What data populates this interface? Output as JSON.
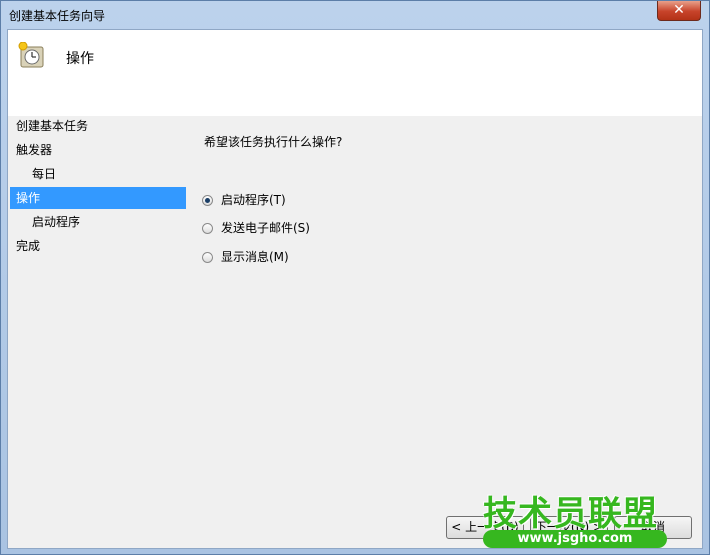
{
  "window": {
    "title": "创建基本任务向导",
    "close_label": "✕"
  },
  "header": {
    "title": "操作",
    "icon": "task-scheduler-clock-icon"
  },
  "nav": {
    "items": [
      {
        "label": "创建基本任务",
        "level": 0,
        "selected": false
      },
      {
        "label": "触发器",
        "level": 0,
        "selected": false
      },
      {
        "label": "每日",
        "level": 1,
        "selected": false
      },
      {
        "label": "操作",
        "level": 0,
        "selected": true
      },
      {
        "label": "启动程序",
        "level": 1,
        "selected": false
      },
      {
        "label": "完成",
        "level": 0,
        "selected": false
      }
    ]
  },
  "main": {
    "question": "希望该任务执行什么操作?",
    "options": [
      {
        "label": "启动程序(T)",
        "checked": true
      },
      {
        "label": "发送电子邮件(S)",
        "checked": false
      },
      {
        "label": "显示消息(M)",
        "checked": false
      }
    ]
  },
  "buttons": {
    "back": "< 上一步(B)",
    "next": "下一步(N) >",
    "cancel": "取消"
  },
  "watermark": {
    "text_big": "技术员联盟",
    "text_small": "www.jsgho.com"
  },
  "colors": {
    "selection": "#3399ff",
    "watermark_green": "#36b71f"
  }
}
